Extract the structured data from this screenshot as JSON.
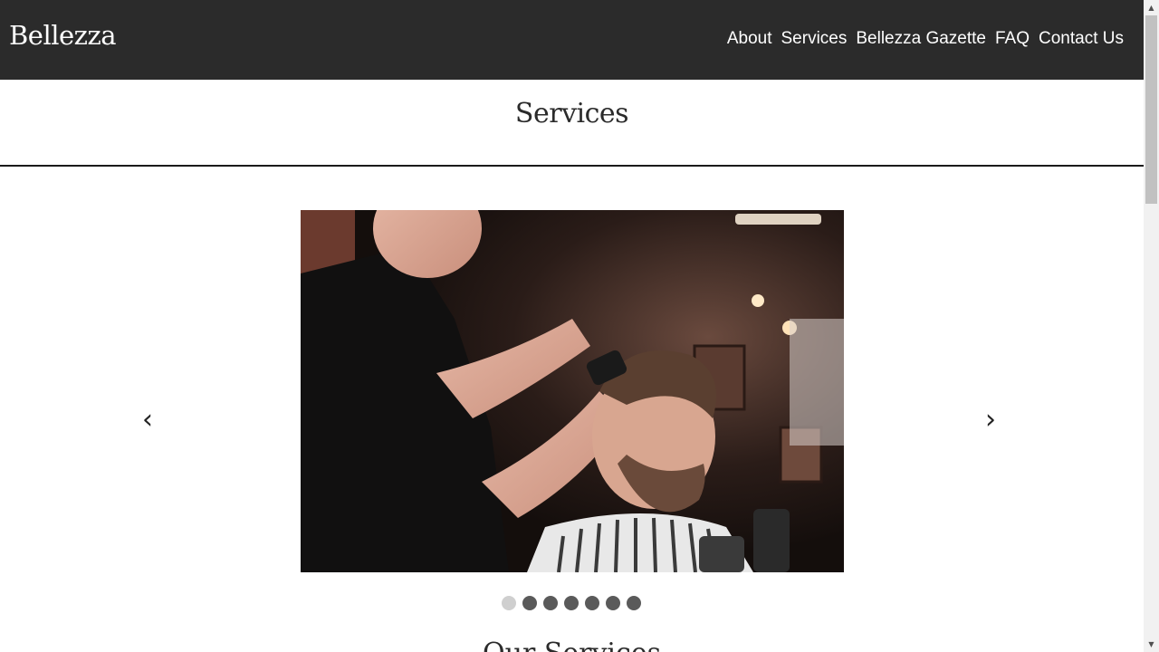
{
  "header": {
    "brand": "Bellezza",
    "nav": [
      {
        "label": "About"
      },
      {
        "label": "Services"
      },
      {
        "label": "Bellezza Gazette"
      },
      {
        "label": "FAQ"
      },
      {
        "label": "Contact Us"
      }
    ]
  },
  "main": {
    "title": "Services",
    "carousel": {
      "prev_label": "‹",
      "next_label": "›",
      "slide_count": 7,
      "active_slide": 1
    },
    "next_section_title": "Our Services"
  },
  "colors": {
    "navbar_bg": "#2b2b2b",
    "dot_active": "#cfcfcf",
    "dot_inactive": "#5a5a5a"
  }
}
